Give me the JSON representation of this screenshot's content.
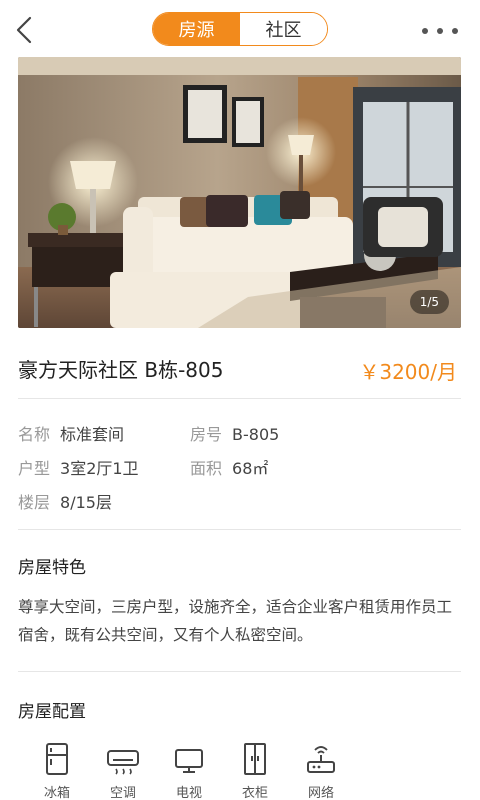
{
  "header": {
    "tabs": [
      {
        "label": "房源",
        "active": true
      },
      {
        "label": "社区",
        "active": false
      }
    ]
  },
  "photo": {
    "counter": "1/5"
  },
  "listing": {
    "title": "豪方天际社区 B栋-805",
    "price": "￥3200/月"
  },
  "details": {
    "name_label": "名称",
    "name_value": "标准套间",
    "room_label": "房号",
    "room_value": "B-805",
    "layout_label": "户型",
    "layout_value": "3室2厅1卫",
    "area_label": "面积",
    "area_value": "68㎡",
    "floor_label": "楼层",
    "floor_value": "8/15层"
  },
  "features": {
    "title": "房屋特色",
    "text": "尊享大空间，三房户型，设施齐全，适合企业客户租赁用作员工宿舍，既有公共空间，又有个人私密空间。"
  },
  "config": {
    "title": "房屋配置",
    "items": [
      {
        "label": "冰箱",
        "icon": "fridge-icon"
      },
      {
        "label": "空调",
        "icon": "air-conditioner-icon"
      },
      {
        "label": "电视",
        "icon": "tv-icon"
      },
      {
        "label": "衣柜",
        "icon": "wardrobe-icon"
      },
      {
        "label": "网络",
        "icon": "router-icon"
      }
    ]
  },
  "colors": {
    "accent": "#f28a1c"
  }
}
